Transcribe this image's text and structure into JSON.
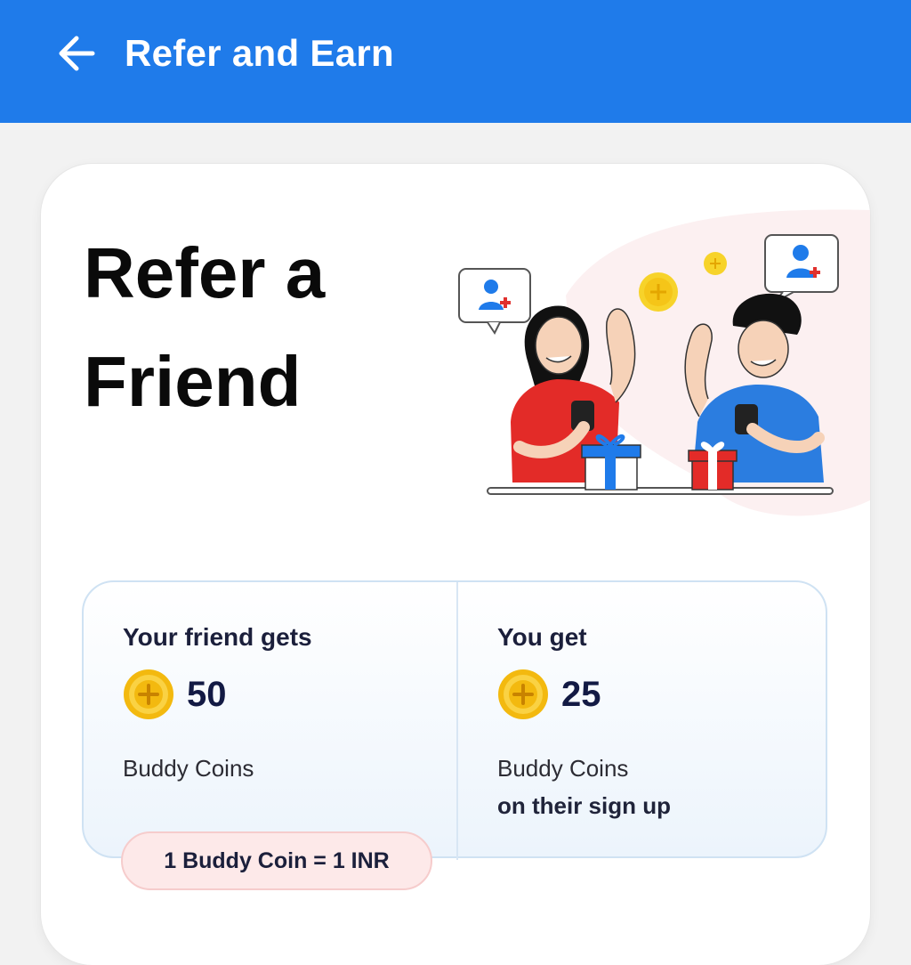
{
  "appbar": {
    "back_icon": "arrow-left-icon",
    "title": "Refer and Earn",
    "background": "#1f7bea"
  },
  "hero": {
    "title": "Refer a Friend",
    "illustration": "friends-referral-illustration"
  },
  "rewards": {
    "friend": {
      "heading": "Your friend gets",
      "coin_icon": "coin-icon",
      "amount": "50",
      "unit": "Buddy Coins"
    },
    "you": {
      "heading": "You get",
      "coin_icon": "coin-icon",
      "amount": "25",
      "unit": "Buddy Coins",
      "condition": "on their sign up"
    }
  },
  "rate": {
    "text": "1 Buddy Coin = 1 INR"
  },
  "colors": {
    "primary": "#1f7bea",
    "coin": "#f5c518",
    "pill_bg": "#fde9e9"
  }
}
